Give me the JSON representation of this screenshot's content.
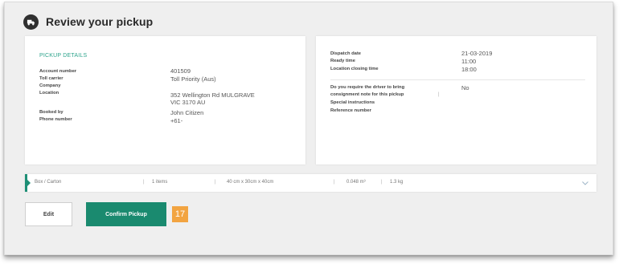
{
  "page": {
    "title": "Review your pickup",
    "icons": {
      "title": "truck-icon",
      "expand": "chevron-down-icon",
      "item_marker": "arrow-right-icon"
    },
    "colors": {
      "accent": "#1a8a6f",
      "heading_green": "#2ea48c",
      "badge": "#f2a441",
      "background": "#efefef"
    }
  },
  "pickup_details": {
    "heading": "PICKUP DETAILS",
    "fields": [
      {
        "label": "Account number",
        "value": "401509"
      },
      {
        "label": "Toll carrier",
        "value": "Toll Priority (Aus)"
      },
      {
        "label": "Company",
        "value": ""
      },
      {
        "label": "Location",
        "value": "352 Wellington Rd MULGRAVE\nVIC 3170 AU"
      },
      {
        "label": "Booked by",
        "value": "John Citizen"
      },
      {
        "label": "Phone number",
        "value": "+61-"
      }
    ]
  },
  "dispatch": {
    "fields": [
      {
        "label": "Dispatch date",
        "value": "21-03-2019"
      },
      {
        "label": "Ready time",
        "value": "11:00"
      },
      {
        "label": "Location closing time",
        "value": "18:00"
      }
    ],
    "driver_question": {
      "label_line1": "Do you require the driver to bring",
      "label_line2": "consignment note for this pickup",
      "value": "No"
    },
    "special_instructions": "Special instructions",
    "reference_number": "Reference number"
  },
  "item": {
    "type": "Box / Carton",
    "count": "1 items",
    "dimensions": "40 cm x 30cm x 40cm",
    "volume": "0.048 m³",
    "weight": "1.3 kg"
  },
  "actions": {
    "edit_label": "Edit",
    "confirm_label": "Confirm Pickup",
    "step_number": "17"
  }
}
